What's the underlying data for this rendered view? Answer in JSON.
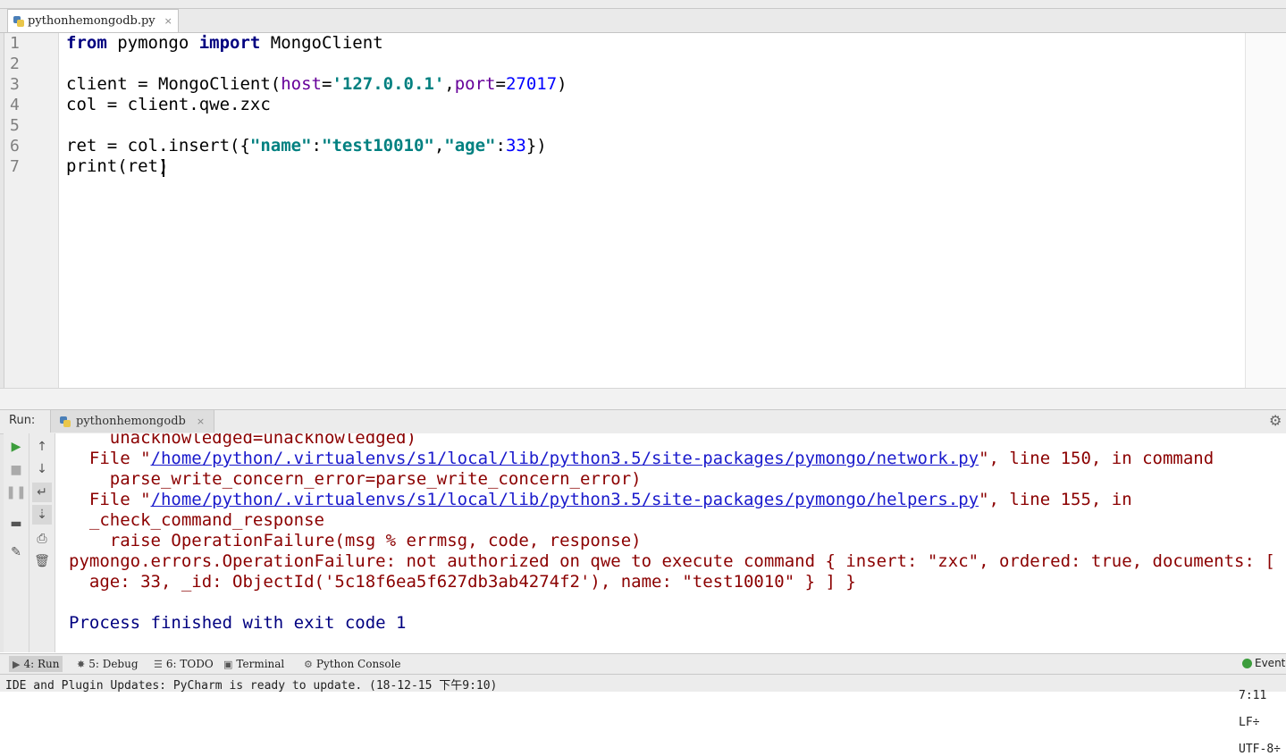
{
  "editor": {
    "tab_label": "pythonhemongodb.py",
    "tab_close": "×",
    "line_numbers": [
      "1",
      "2",
      "3",
      "4",
      "5",
      "6",
      "7"
    ],
    "lines": [
      [
        {
          "t": "from",
          "c": "kw"
        },
        {
          "t": " pymongo ",
          "c": ""
        },
        {
          "t": "import",
          "c": "kw"
        },
        {
          "t": " MongoClient",
          "c": ""
        }
      ],
      [],
      [
        {
          "t": "client = MongoClient(",
          "c": ""
        },
        {
          "t": "host",
          "c": "param"
        },
        {
          "t": "=",
          "c": ""
        },
        {
          "t": "'127.0.0.1'",
          "c": "str"
        },
        {
          "t": ",",
          "c": ""
        },
        {
          "t": "port",
          "c": "param"
        },
        {
          "t": "=",
          "c": ""
        },
        {
          "t": "27017",
          "c": "num"
        },
        {
          "t": ")",
          "c": ""
        }
      ],
      [
        {
          "t": "col = client.qwe.zxc",
          "c": ""
        }
      ],
      [],
      [
        {
          "t": "ret = col.insert({",
          "c": ""
        },
        {
          "t": "\"name\"",
          "c": "str"
        },
        {
          "t": ":",
          "c": ""
        },
        {
          "t": "\"test10010\"",
          "c": "str"
        },
        {
          "t": ",",
          "c": ""
        },
        {
          "t": "\"age\"",
          "c": "str"
        },
        {
          "t": ":",
          "c": ""
        },
        {
          "t": "33",
          "c": "num"
        },
        {
          "t": "})",
          "c": ""
        }
      ],
      [
        {
          "t": "print(ret)",
          "c": ""
        }
      ]
    ]
  },
  "run_panel": {
    "label": "Run:",
    "tab_label": "pythonhemongodb",
    "tab_close": "×",
    "output_lines": [
      {
        "text": "    unacknowledged=unacknowledged)"
      },
      {
        "pre": "  File \"",
        "link": "/home/python/.virtualenvs/s1/local/lib/python3.5/site-packages/pymongo/network.py",
        "post": "\", line 150, in command"
      },
      {
        "text": "    parse_write_concern_error=parse_write_concern_error)"
      },
      {
        "pre": "  File \"",
        "link": "/home/python/.virtualenvs/s1/local/lib/python3.5/site-packages/pymongo/helpers.py",
        "post": "\", line 155, in"
      },
      {
        "text": "  _check_command_response"
      },
      {
        "text": "    raise OperationFailure(msg % errmsg, code, response)"
      },
      {
        "text": "pymongo.errors.OperationFailure: not authorized on qwe to execute command { insert: \"zxc\", ordered: true, documents: [ {"
      },
      {
        "text": "  age: 33, _id: ObjectId('5c18f6ea5f627db3ab4274f2'), name: \"test10010\" } ] }"
      },
      {
        "text": ""
      },
      {
        "text": "Process finished with exit code 1",
        "cls": "exit"
      }
    ]
  },
  "tool_windows": [
    {
      "label": "4: Run",
      "icon": "run-icon"
    },
    {
      "label": "5: Debug",
      "icon": "debug-icon"
    },
    {
      "label": "6: TODO",
      "icon": "todo-icon"
    },
    {
      "label": "Terminal",
      "icon": "terminal-icon"
    },
    {
      "label": "Python Console",
      "icon": "python-console-icon"
    }
  ],
  "event_log": "Event",
  "status": {
    "message": "IDE and Plugin Updates: PyCharm is ready to update. (18-12-15 下午9:10)",
    "caret_position": "7:11",
    "line_separator": "LF÷",
    "encoding": "UTF-8÷"
  }
}
